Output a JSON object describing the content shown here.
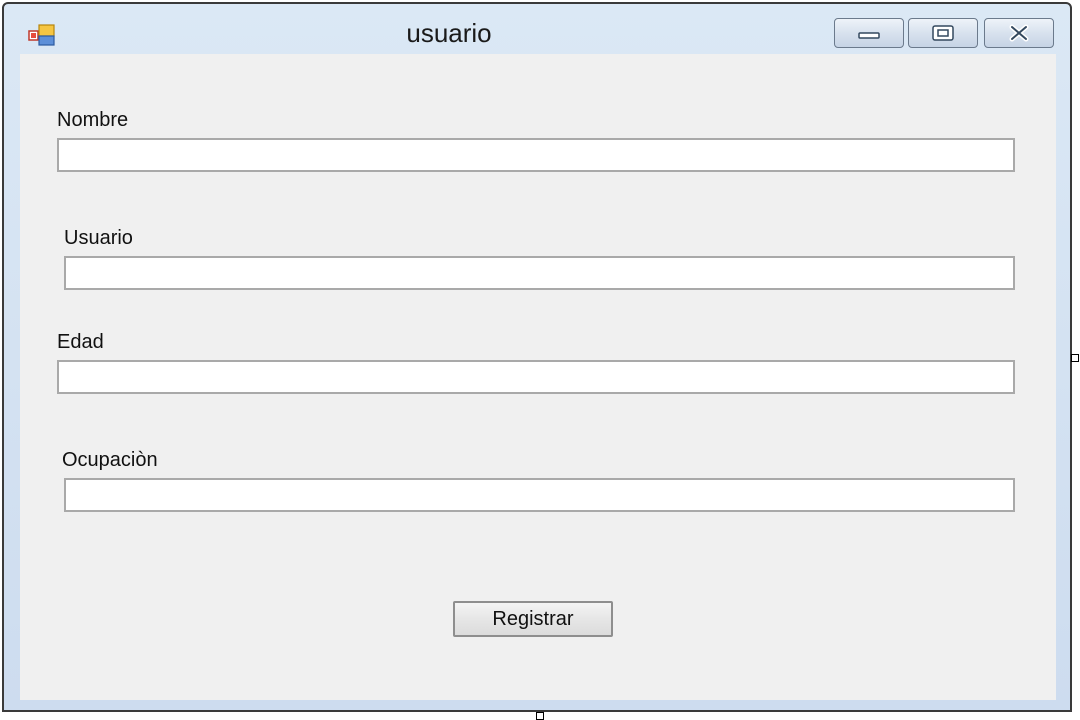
{
  "window": {
    "title": "usuario"
  },
  "form": {
    "fields": [
      {
        "label": "Nombre",
        "value": ""
      },
      {
        "label": "Usuario",
        "value": ""
      },
      {
        "label": "Edad",
        "value": ""
      },
      {
        "label": "Ocupaciòn",
        "value": ""
      }
    ],
    "submit_label": "Registrar"
  },
  "icons": {
    "app": "winforms-app-icon",
    "minimize": "minimize-icon",
    "maximize": "maximize-icon",
    "close": "close-icon"
  },
  "colors": {
    "titlebar": "#cddcef",
    "client_background": "#f0f0f0",
    "input_background": "#ffffff",
    "input_border": "#a9a9a9"
  }
}
